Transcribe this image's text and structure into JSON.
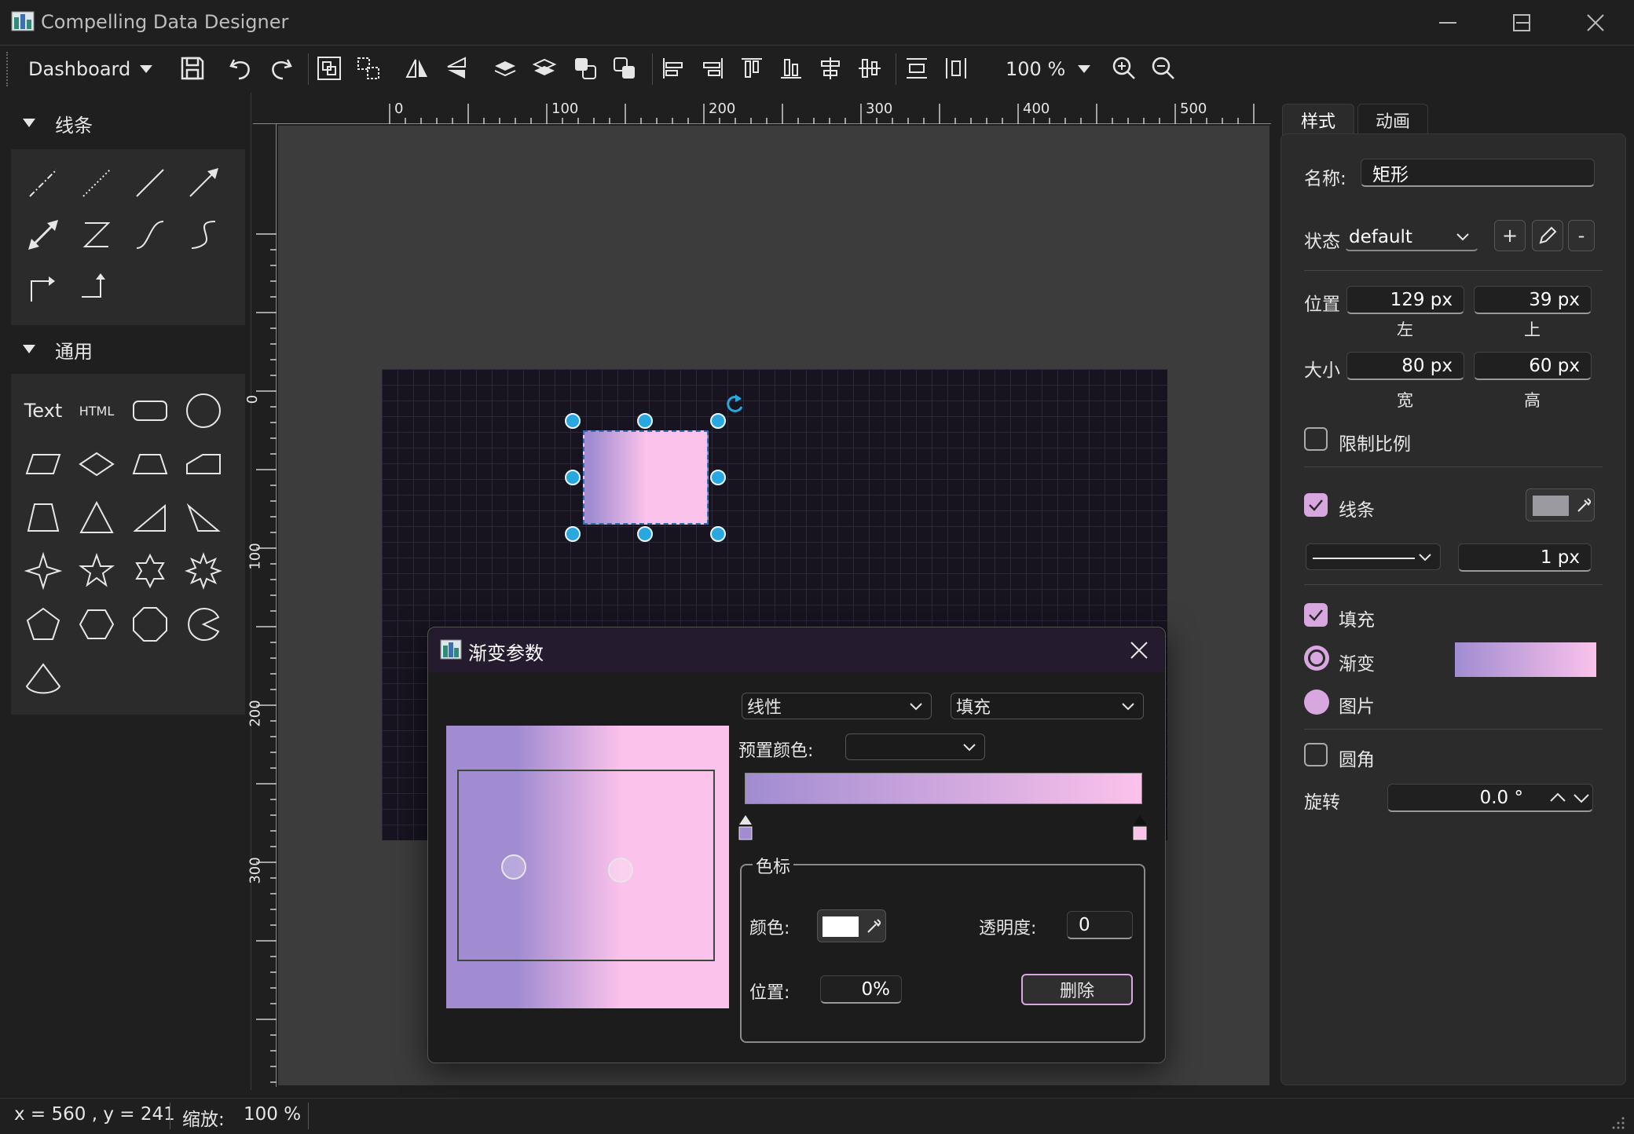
{
  "window": {
    "title": "Compelling Data Designer"
  },
  "toolbar": {
    "dashboard_label": "Dashboard",
    "zoom": "100 %"
  },
  "left_panel": {
    "lines_header": "线条",
    "general_header": "通用",
    "text_shape": "Text",
    "html_shape": "HTML"
  },
  "ruler": {
    "top_labels": [
      "0",
      "100",
      "200",
      "300",
      "400",
      "500"
    ],
    "left_labels": [
      "0",
      "100",
      "200",
      "300"
    ]
  },
  "right_panel": {
    "tabs": [
      "样式",
      "动画"
    ],
    "name_label": "名称:",
    "name_value": "矩形",
    "state_label": "状态",
    "state_value": "default",
    "state_add": "+",
    "state_remove": "-",
    "position_label": "位置",
    "left_value": "129 px",
    "top_value": "39 px",
    "left_caption": "左",
    "top_caption": "上",
    "size_label": "大小",
    "width_value": "80 px",
    "height_value": "60 px",
    "width_caption": "宽",
    "height_caption": "高",
    "lock_ratio": "限制比例",
    "stroke_label": "线条",
    "stroke_width": "1 px",
    "fill_label": "填充",
    "gradient_label": "渐变",
    "image_label": "图片",
    "rounded_label": "圆角",
    "rotation_label": "旋转",
    "rotation_value": "0.0 °",
    "colors": {
      "gradient_start": "#a18cd1",
      "gradient_end": "#fbc2eb",
      "check": "#d9a7e0"
    }
  },
  "dialog": {
    "title": "渐变参数",
    "type_value": "线性",
    "mode_value": "填充",
    "preset_label": "预置颜色:",
    "preset_value": "",
    "stop_group": "色标",
    "color_label": "颜色:",
    "opacity_label": "透明度:",
    "opacity_value": "0",
    "position_label": "位置:",
    "position_value": "0%",
    "delete_button": "删除"
  },
  "status": {
    "coords": "x = 560 , y = 241",
    "zoom_label": "缩放:",
    "zoom_value": "100 %"
  }
}
